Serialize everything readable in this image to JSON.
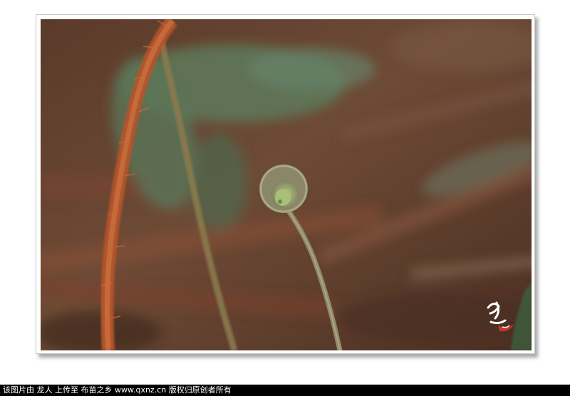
{
  "caption": {
    "text": "该图片由 龙人 上传至 布苗之乡 www.qxnz.cn 版权归原创者所有"
  },
  "photo": {
    "subject": "fiddlehead-fern",
    "colors": {
      "background_brown": "#6b4a35",
      "leaf_green": "#5d7a5a",
      "fern_stem": "#8f8b6a",
      "fern_curl_center": "#a9c07a",
      "hairy_stem": "#b4542a"
    }
  },
  "watermark": {
    "kind": "calligraphy-seal"
  }
}
